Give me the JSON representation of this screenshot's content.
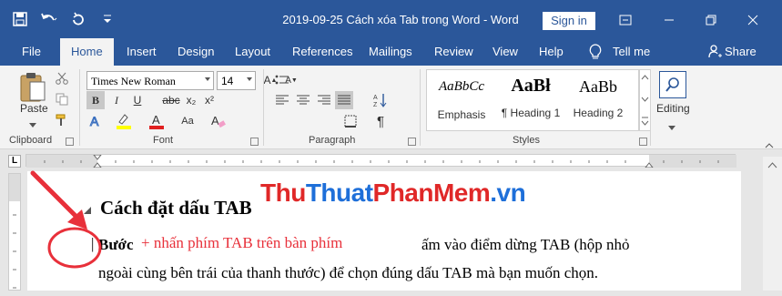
{
  "window": {
    "title": "2019-09-25 Cách xóa Tab trong Word  -  Word",
    "signin_label": "Sign in"
  },
  "tabs": [
    "File",
    "Home",
    "Insert",
    "Design",
    "Layout",
    "References",
    "Mailings",
    "Review",
    "View",
    "Help"
  ],
  "tell_me": "Tell me",
  "share": "Share",
  "ribbon": {
    "clipboard": {
      "label": "Clipboard",
      "paste": "Paste"
    },
    "font": {
      "label": "Font",
      "font_name": "Times New Roman",
      "font_size": "14",
      "bold": "B",
      "italic": "I",
      "underline": "U",
      "strike": "abc",
      "subscript": "x₂",
      "superscript": "x²",
      "grow": "A",
      "shrink": "A",
      "case": "Aa",
      "clear": "A"
    },
    "paragraph": {
      "label": "Paragraph",
      "pilcrow": "¶"
    },
    "styles": {
      "label": "Styles",
      "items": [
        {
          "preview": "AaBbCc",
          "name": "Emphasis"
        },
        {
          "preview": "AaBł",
          "name": "¶ Heading 1"
        },
        {
          "preview": "AaBb",
          "name": "Heading 2"
        }
      ]
    },
    "editing": {
      "label": "Editing"
    }
  },
  "ruler": {
    "tab_marker": "L"
  },
  "document": {
    "heading": "Cách đặt dấu TAB",
    "line1_bold": "Bước",
    "line1_rest": "ấm vào điểm dừng TAB (hộp nhỏ",
    "line2": "ngoài cùng bên trái của thanh thước) để chọn đúng dấu TAB mà bạn muốn chọn.",
    "annotation": "+ nhấn phím TAB trên bàn phím"
  },
  "watermark": {
    "part1": "Thu",
    "part2": "Thuat",
    "part3": "PhanMem",
    "part4": ".vn"
  },
  "colors": {
    "brand": "#2b579a",
    "annotation_red": "#e8303a",
    "watermark_red": "#e02828",
    "watermark_blue": "#1e6fd9"
  }
}
